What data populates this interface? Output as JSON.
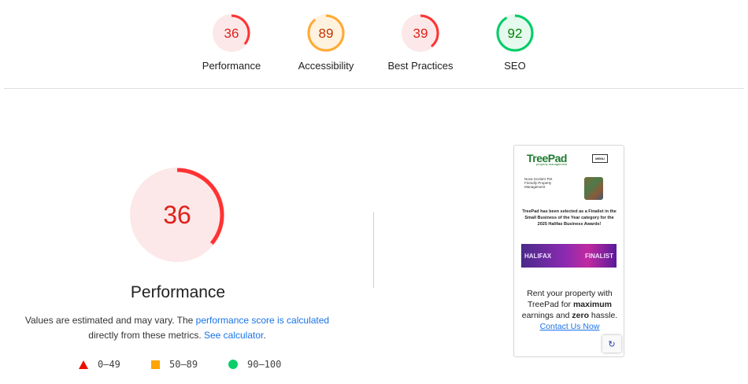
{
  "colors": {
    "fail": "#ff3333",
    "fail_bg": "#fce8e8",
    "average": "#ffaa33",
    "average_bg": "#fff3e0",
    "pass": "#00cc66",
    "pass_bg": "#e6f9ef"
  },
  "scores": [
    {
      "label": "Performance",
      "value": 36,
      "status": "fail"
    },
    {
      "label": "Accessibility",
      "value": 89,
      "status": "average"
    },
    {
      "label": "Best Practices",
      "value": 39,
      "status": "fail"
    },
    {
      "label": "SEO",
      "value": 92,
      "status": "pass"
    }
  ],
  "performance": {
    "score": "36",
    "score_value": 36,
    "title": "Performance",
    "desc_prefix": "Values are estimated and may vary. The ",
    "desc_link1": "performance score is calculated",
    "desc_middle": " directly from these metrics. ",
    "desc_link2": "See calculator",
    "desc_suffix": "."
  },
  "legend": [
    {
      "icon": "triangle-icon",
      "range": "0–49"
    },
    {
      "icon": "square-icon",
      "range": "50–89"
    },
    {
      "icon": "circle-icon",
      "range": "90–100"
    }
  ],
  "screenshot": {
    "logo": "TreePad",
    "logo_sub": "property management",
    "menu": "MENU",
    "small_text": "Nova Scotia's Pet Friendly Property Management",
    "award_text": "TreePad has been selected as a Finalist in the Small Business of the Year category for the 2025 Halifax Business Awards!",
    "banner_left": "HALIFAX",
    "banner_right": "FINALIST",
    "rent_1": "Rent your property with TreePad for ",
    "rent_bold1": "maximum",
    "rent_2": " earnings and ",
    "rent_bold2": "zero",
    "rent_3": " hassle. ",
    "rent_link": "Contact Us Now"
  }
}
